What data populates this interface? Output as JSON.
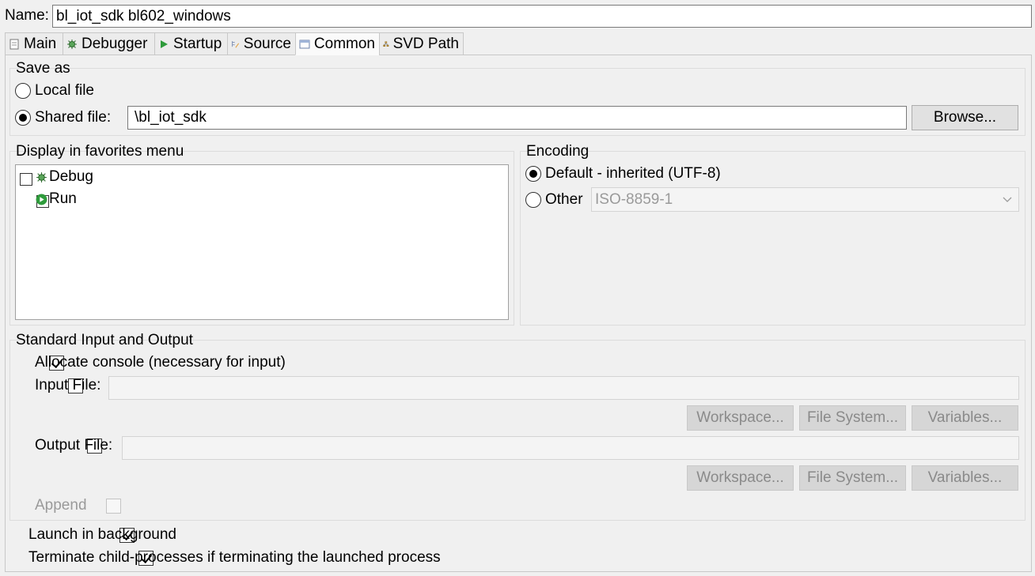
{
  "name": {
    "label": "Name:",
    "value": "bl_iot_sdk bl602_windows"
  },
  "tabs": [
    {
      "label": "Main",
      "icon": "page-icon"
    },
    {
      "label": "Debugger",
      "icon": "bug-icon"
    },
    {
      "label": "Startup",
      "icon": "play-icon"
    },
    {
      "label": "Source",
      "icon": "source-icon"
    },
    {
      "label": "Common",
      "icon": "common-icon"
    },
    {
      "label": "SVD Path",
      "icon": "svd-icon"
    }
  ],
  "save_as": {
    "title": "Save as",
    "local_label": "Local file",
    "shared_label": "Shared file:",
    "shared_value": "\\bl_iot_sdk",
    "browse_label": "Browse..."
  },
  "favorites": {
    "title": "Display in favorites menu",
    "items": [
      {
        "label": "Debug",
        "checked": false
      },
      {
        "label": "Run",
        "checked": false
      }
    ]
  },
  "encoding": {
    "title": "Encoding",
    "default_label": "Default - inherited (UTF-8)",
    "other_label": "Other",
    "other_value": "ISO-8859-1"
  },
  "stdio": {
    "title": "Standard Input and Output",
    "allocate_label": "Allocate console (necessary for input)",
    "input_label": "Input File:",
    "output_label": "Output File:",
    "workspace_label": "Workspace...",
    "filesystem_label": "File System...",
    "variables_label": "Variables...",
    "append_label": "Append"
  },
  "launch_background_label": "Launch in background",
  "terminate_label": "Terminate child-processes if terminating the launched process",
  "colors": {
    "accent_green": "#2e9b3b",
    "bug_green": "#3c8d3c"
  }
}
